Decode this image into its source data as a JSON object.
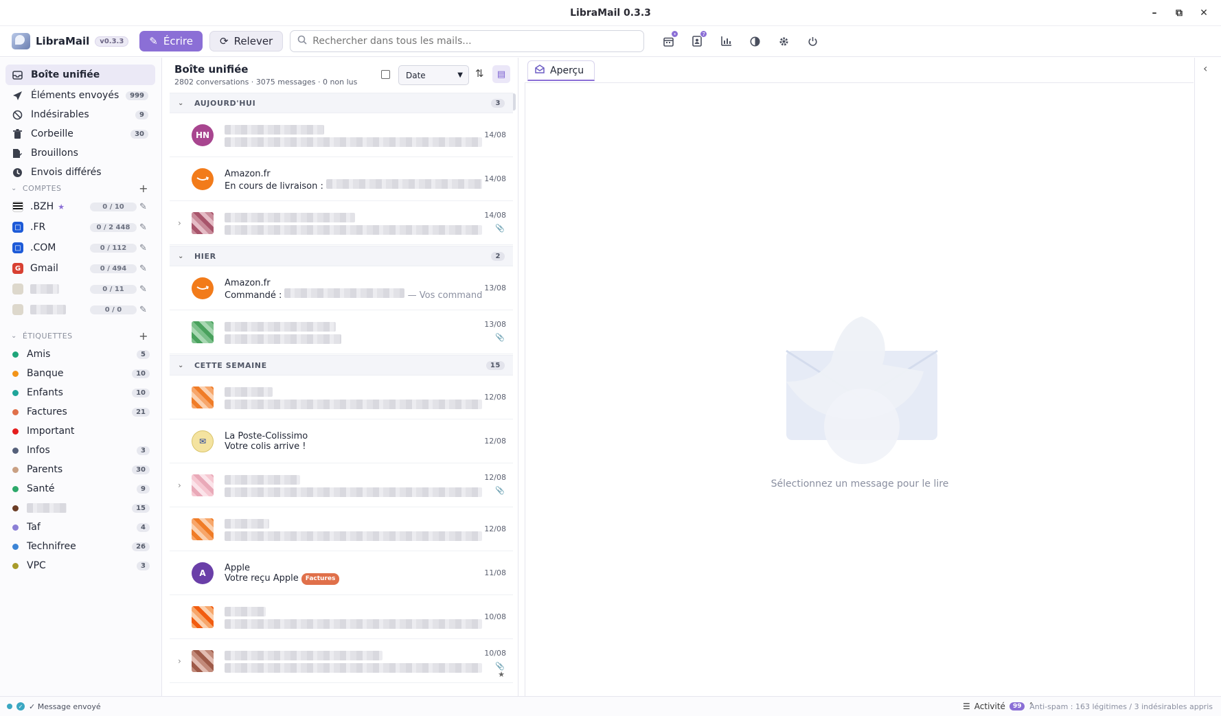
{
  "window": {
    "title": "LibraMail 0.3.3"
  },
  "brand": {
    "name": "LibraMail",
    "version": "v0.3.3"
  },
  "toolbar": {
    "compose_label": "Écrire",
    "fetch_label": "Relever",
    "search_placeholder": "Rechercher dans tous les mails...",
    "contacts_badge": "7",
    "calendar_badge": "•"
  },
  "sidebar": {
    "folders": [
      {
        "label": "Boîte unifiée",
        "icon": "inbox-icon",
        "count": ""
      },
      {
        "label": "Éléments envoyés",
        "icon": "paper-plane-icon",
        "count": "999"
      },
      {
        "label": "Indésirables",
        "icon": "ban-icon",
        "count": "9"
      },
      {
        "label": "Corbeille",
        "icon": "trash-icon",
        "count": "30"
      },
      {
        "label": "Brouillons",
        "icon": "draft-icon",
        "count": ""
      },
      {
        "label": "Envois différés",
        "icon": "clock-icon",
        "count": ""
      }
    ],
    "accounts_header": "COMPTES",
    "accounts": [
      {
        "label": ".BZH",
        "ratio": "0 / 10",
        "color": "#2c2c2c"
      },
      {
        "label": ".FR",
        "ratio": "0 / 2 448",
        "color": "#1e5bd8"
      },
      {
        "label": ".COM",
        "ratio": "0 / 112",
        "color": "#1e5bd8"
      },
      {
        "label": "Gmail",
        "ratio": "0 / 494",
        "color": "#d84032"
      },
      {
        "label": "",
        "ratio": "0 / 11",
        "color": "#b9b4a8"
      },
      {
        "label": "",
        "ratio": "0 / 0",
        "color": "#b9b4a8"
      }
    ],
    "labels_header": "ÉTIQUETTES",
    "labels": [
      {
        "label": "Amis",
        "count": "5",
        "color": "#1fa57a"
      },
      {
        "label": "Banque",
        "count": "10",
        "color": "#f2941a"
      },
      {
        "label": "Enfants",
        "count": "10",
        "color": "#1fa59a"
      },
      {
        "label": "Factures",
        "count": "21",
        "color": "#e0704a"
      },
      {
        "label": "Important",
        "count": "",
        "color": "#e51d1d"
      },
      {
        "label": "Infos",
        "count": "3",
        "color": "#55607a"
      },
      {
        "label": "Parents",
        "count": "30",
        "color": "#c9a083"
      },
      {
        "label": "Santé",
        "count": "9",
        "color": "#2ca86a"
      },
      {
        "label": "",
        "count": "15",
        "color": "#6b3d26"
      },
      {
        "label": "Taf",
        "count": "4",
        "color": "#8b7fd6"
      },
      {
        "label": "Technifree",
        "count": "26",
        "color": "#3b84d6"
      },
      {
        "label": "VPC",
        "count": "3",
        "color": "#a89b2a"
      }
    ]
  },
  "list": {
    "title": "Boîte unifiée",
    "subtitle": "2802 conversations · 3075 messages · 0 non lus",
    "sort_label": "Date",
    "groups": [
      {
        "label": "AUJOURD'HUI",
        "count": "3"
      },
      {
        "label": "HIER",
        "count": "2"
      },
      {
        "label": "CETTE SEMAINE",
        "count": "15"
      }
    ],
    "rows": [
      {
        "avatar": "HN",
        "sender": "",
        "subject": "",
        "snippet": "",
        "date": "14/08",
        "tag": ""
      },
      {
        "avatar": "",
        "sender": "Amazon.fr",
        "subject": "En cours de livraison :",
        "snippet": "",
        "date": "14/08",
        "tag": ""
      },
      {
        "avatar": "",
        "sender": "",
        "subject": "",
        "snippet": "",
        "date": "14/08",
        "tag": ""
      },
      {
        "avatar": "",
        "sender": "Amazon.fr",
        "subject": "Commandé :",
        "snippet": "— Vos commande…",
        "date": "13/08",
        "tag": ""
      },
      {
        "avatar": "",
        "sender": "",
        "subject": "",
        "snippet": "",
        "date": "13/08",
        "tag": ""
      },
      {
        "avatar": "",
        "sender": "",
        "subject": "",
        "snippet": "",
        "date": "12/08",
        "tag": ""
      },
      {
        "avatar": "",
        "sender": "La Poste-Colissimo",
        "subject": "Votre colis arrive !",
        "snippet": "",
        "date": "12/08",
        "tag": ""
      },
      {
        "avatar": "",
        "sender": "",
        "subject": "",
        "snippet": "",
        "date": "12/08",
        "tag": ""
      },
      {
        "avatar": "",
        "sender": "",
        "subject": "",
        "snippet": "",
        "date": "12/08",
        "tag": ""
      },
      {
        "avatar": "A",
        "sender": "Apple",
        "subject": "Votre reçu Apple",
        "snippet": "",
        "date": "11/08",
        "tag": "Factures"
      },
      {
        "avatar": "",
        "sender": "",
        "subject": "",
        "snippet": "",
        "date": "10/08",
        "tag": ""
      },
      {
        "avatar": "",
        "sender": "",
        "subject": "",
        "snippet": "",
        "date": "10/08",
        "tag": ""
      }
    ]
  },
  "preview": {
    "tab_label": "Aperçu",
    "empty_text": "Sélectionnez un message pour le lire"
  },
  "status": {
    "message": "✓ Message envoyé",
    "activity_label": "Activité",
    "activity_count": "99",
    "antispam": "Anti-spam : 163 légitimes / 3 indésirables appris"
  },
  "colors": {
    "accent": "#8b6fd6",
    "amazon": "#f27b1a",
    "apple": "#6a3fa8",
    "hn": "#a8458f"
  }
}
